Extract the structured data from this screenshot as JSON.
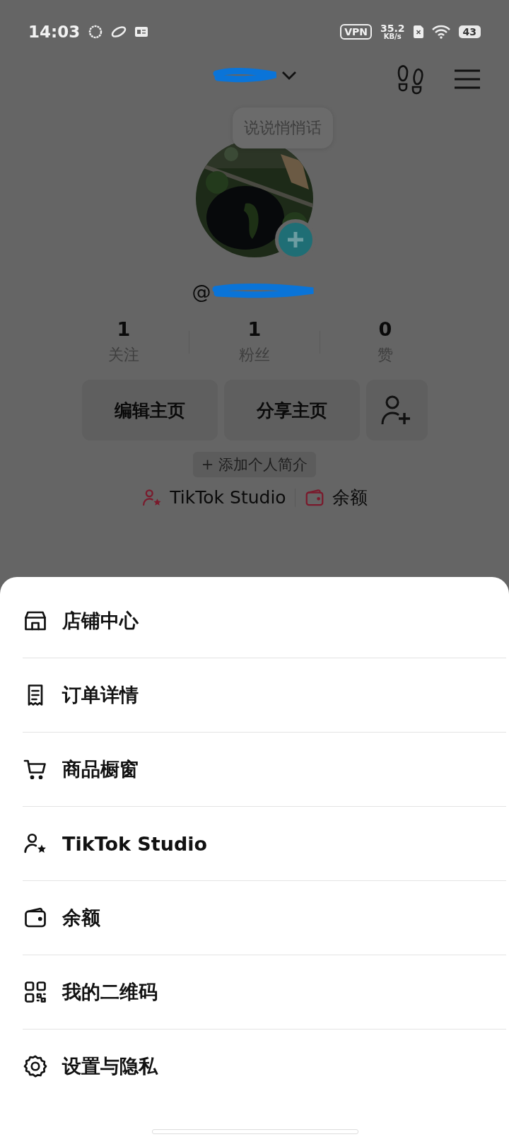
{
  "status_bar": {
    "time": "14:03",
    "vpn": "VPN",
    "speed_value": "35.2",
    "speed_unit": "KB/s",
    "battery": "43"
  },
  "profile": {
    "handle_prefix": "@",
    "bubble": "说说悄悄话",
    "stats": [
      {
        "value": "1",
        "label": "关注"
      },
      {
        "value": "1",
        "label": "粉丝"
      },
      {
        "value": "0",
        "label": "赞"
      }
    ],
    "buttons": [
      "编辑主页",
      "分享主页"
    ],
    "add_bio": "+ 添加个人简介",
    "links": [
      {
        "kind": "studio",
        "label": "TikTok Studio"
      },
      {
        "kind": "wallet",
        "label": "余额"
      }
    ]
  },
  "menu": [
    {
      "kind": "store",
      "label": "店铺中心"
    },
    {
      "kind": "receipt",
      "label": "订单详情"
    },
    {
      "kind": "cart",
      "label": "商品橱窗"
    },
    {
      "kind": "studio",
      "label": "TikTok Studio"
    },
    {
      "kind": "wallet",
      "label": "余额"
    },
    {
      "kind": "qr",
      "label": "我的二维码"
    },
    {
      "kind": "settings",
      "label": "设置与隐私"
    }
  ]
}
